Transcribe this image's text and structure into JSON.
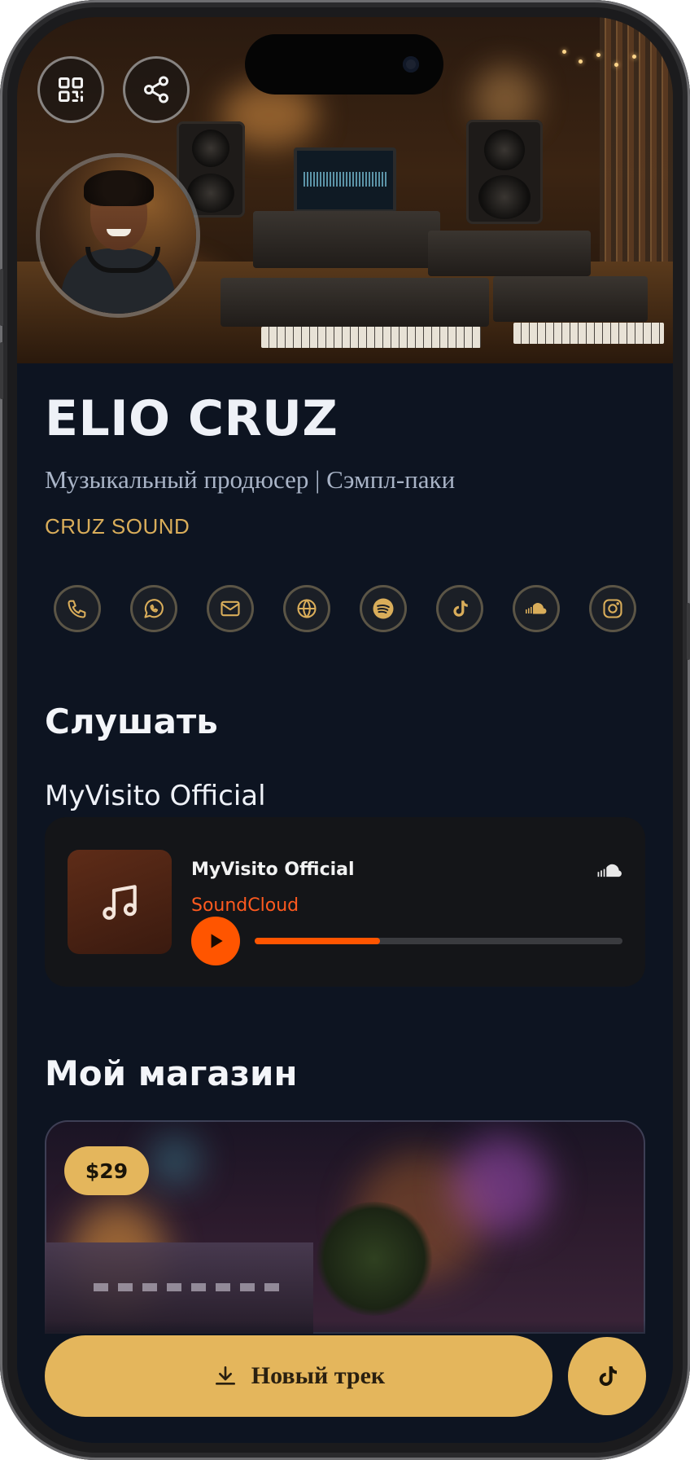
{
  "profile": {
    "name": "ELIO CRUZ",
    "title": "Музыкальный продюсер | Сэмпл-паки",
    "company": "CRUZ SOUND"
  },
  "header_actions": [
    {
      "icon": "qr-code-icon"
    },
    {
      "icon": "share-icon"
    }
  ],
  "socials": [
    {
      "icon": "phone-icon"
    },
    {
      "icon": "whatsapp-icon"
    },
    {
      "icon": "mail-icon"
    },
    {
      "icon": "globe-icon"
    },
    {
      "icon": "spotify-icon"
    },
    {
      "icon": "tiktok-icon"
    },
    {
      "icon": "soundcloud-icon"
    },
    {
      "icon": "instagram-icon"
    }
  ],
  "listen": {
    "heading": "Слушать",
    "playlist_label": "MyVisito Official",
    "player": {
      "track_title": "MyVisito Official",
      "source": "SoundCloud",
      "progress": 0.34,
      "cover_icon": "music-note-icon",
      "brand_icon": "soundcloud-icon",
      "state": "paused"
    }
  },
  "shop": {
    "heading": "Мой магазин",
    "items": [
      {
        "price": "$29"
      }
    ]
  },
  "cta": {
    "label": "Новый трек",
    "icon": "download-icon"
  },
  "fab": {
    "icon": "tiktok-icon"
  },
  "colors": {
    "background": "#0d1421",
    "accent_gold": "#e4b65c",
    "company_gold": "#d9ad5a",
    "soundcloud_orange": "#ff5500"
  }
}
